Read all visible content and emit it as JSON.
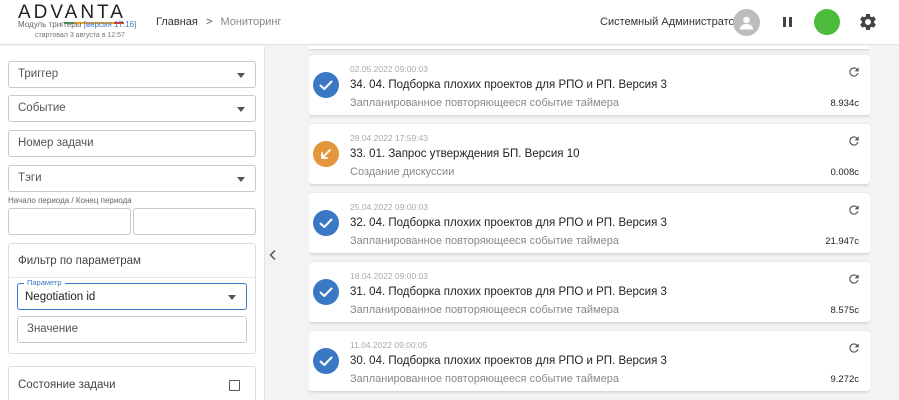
{
  "header": {
    "logo": "ADVANTA",
    "module_text": "Модуль триггеры",
    "version": "[версия 17.16]",
    "started": "стартовал 3 августа в 12:57",
    "breadcrumb": {
      "home": "Главная",
      "separator": ">",
      "current": "Мониторинг"
    },
    "user_name": "Системный Администратор",
    "status_color": "#4cbb3c"
  },
  "filters": {
    "trigger": "Триггер",
    "event": "Событие",
    "task_number": "Номер задачи",
    "tags": "Тэги",
    "period_label": "Начало периода / Конец периода",
    "param_filter_title": "Фильтр по параметрам",
    "param_legend": "Параметр",
    "param_selected": "Negotiation id",
    "value_placeholder": "Значение",
    "task_state": "Состояние задачи"
  },
  "events": [
    {
      "date": "02.05.2022 09:00:03",
      "title": "34. 04. Подборка плохих проектов для РПО и РП. Версия 3",
      "subtitle": "Запланированное повторяющееся событие таймера",
      "duration": "8.934с",
      "status": "success"
    },
    {
      "date": "28.04.2022 17:59:43",
      "title": "33. 01. Запрос утверждения БП. Версия 10",
      "subtitle": "Создание дискуссии",
      "duration": "0.008с",
      "status": "warning"
    },
    {
      "date": "25.04.2022 09:00:03",
      "title": "32. 04. Подборка плохих проектов для РПО и РП. Версия 3",
      "subtitle": "Запланированное повторяющееся событие таймера",
      "duration": "21.947с",
      "status": "success"
    },
    {
      "date": "18.04.2022 09:00:03",
      "title": "31. 04. Подборка плохих проектов для РПО и РП. Версия 3",
      "subtitle": "Запланированное повторяющееся событие таймера",
      "duration": "8.575с",
      "status": "success"
    },
    {
      "date": "11.04.2022 09:00:05",
      "title": "30. 04. Подборка плохих проектов для РПО и РП. Версия 3",
      "subtitle": "Запланированное повторяющееся событие таймера",
      "duration": "9.272с",
      "status": "success"
    }
  ],
  "colors": {
    "success": "#3b78c4",
    "warning": "#e3963b",
    "accent": "#3b78c4"
  },
  "icons": {
    "success": "check-icon",
    "warning": "arrow-icon",
    "refresh": "refresh-icon"
  }
}
